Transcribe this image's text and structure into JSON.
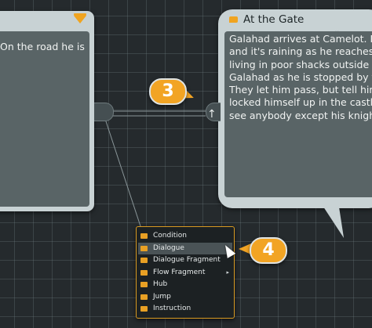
{
  "left_node": {
    "text": "On the road he is"
  },
  "right_node": {
    "title": "At the Gate",
    "lines": [
      "Galahad arrives at Camelot. Darl",
      "and it's raining as he reaches the",
      "living in poor shacks outside the",
      "Galahad as he is stopped by the",
      "They let him pass, but tell him th",
      "locked himself up in the castle a",
      "see anybody except his knights."
    ],
    "more_dots": "..."
  },
  "callouts": {
    "three": "3",
    "four": "4"
  },
  "connector": {
    "input_arrow": "↑"
  },
  "context_menu": {
    "items": [
      {
        "label": "Condition",
        "icon": "condition-icon",
        "submenu": ""
      },
      {
        "label": "Dialogue",
        "icon": "dialogue-icon",
        "submenu": ""
      },
      {
        "label": "Dialogue Fragment",
        "icon": "dialogue-fragment-icon",
        "submenu": ""
      },
      {
        "label": "Flow Fragment",
        "icon": "flow-fragment-icon",
        "submenu": "▸"
      },
      {
        "label": "Hub",
        "icon": "hub-icon",
        "submenu": ""
      },
      {
        "label": "Jump",
        "icon": "jump-icon",
        "submenu": ""
      },
      {
        "label": "Instruction",
        "icon": "instruction-icon",
        "submenu": ""
      }
    ],
    "highlighted": "Dialogue"
  },
  "colors": {
    "accent": "#f2a424",
    "canvas": "#252a2d",
    "node_frame": "#c8d2d4",
    "node_body": "#596466"
  }
}
